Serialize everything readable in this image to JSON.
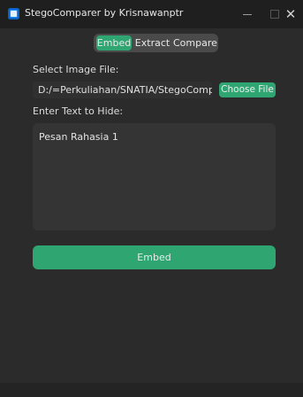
{
  "window": {
    "title": "StegoComparer by Krisnawanptr",
    "minimize_icon": "minimize-icon",
    "maximize_icon": "maximize-icon",
    "close_icon": "close-icon",
    "close_glyph": "✕"
  },
  "tabs": {
    "items": [
      {
        "label": "Embed",
        "selected": true
      },
      {
        "label": "Extract",
        "selected": false
      },
      {
        "label": "Compare",
        "selected": false
      }
    ]
  },
  "embed": {
    "select_label": "Select Image File:",
    "file_path": "D:/=Perkuliahan/SNATIA/StegoComparer",
    "choose_button": "Choose File",
    "text_label": "Enter Text to Hide:",
    "text_value": "Pesan Rahasia 1",
    "embed_button": "Embed"
  },
  "colors": {
    "accent": "#2fa572",
    "background": "#2b2b2b",
    "titlebar": "#1f1f1f",
    "field": "#343434"
  }
}
